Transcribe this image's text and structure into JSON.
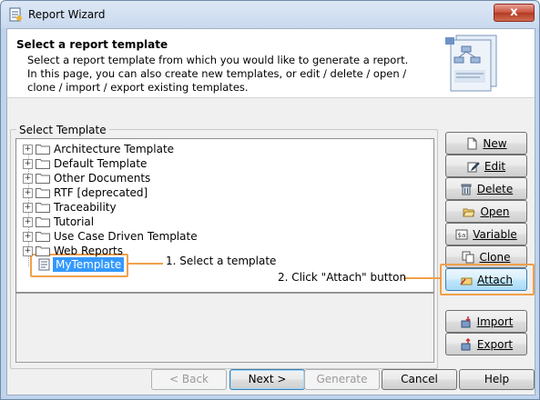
{
  "window": {
    "title": "Report Wizard",
    "close_glyph": "x"
  },
  "header": {
    "title": "Select a report template",
    "description": "Select a report template from which you would like to generate a report. In this page, you can also create new templates, or edit / delete / open / clone / import / export existing templates."
  },
  "template_group": {
    "label": "Select Template",
    "items": [
      {
        "label": "Architecture Template",
        "icon": "folder-icon"
      },
      {
        "label": "Default Template",
        "icon": "folder-icon"
      },
      {
        "label": "Other Documents",
        "icon": "folder-icon"
      },
      {
        "label": "RTF [deprecated]",
        "icon": "folder-icon"
      },
      {
        "label": "Traceability",
        "icon": "folder-icon"
      },
      {
        "label": "Tutorial",
        "icon": "folder-icon"
      },
      {
        "label": "Use Case Driven Template",
        "icon": "folder-icon"
      },
      {
        "label": "Web Reports",
        "icon": "folder-icon"
      }
    ],
    "selected": {
      "label": "MyTemplate",
      "icon": "template-file-icon"
    }
  },
  "side_buttons": {
    "new": "New",
    "edit": "Edit",
    "delete": "Delete",
    "open": "Open",
    "variable": "Variable",
    "clone": "Clone",
    "attach": "Attach",
    "import": "Import",
    "export": "Export"
  },
  "footer": {
    "back": "< Back",
    "next": "Next >",
    "generate": "Generate",
    "cancel": "Cancel",
    "help": "Help"
  },
  "annotations": {
    "step1": "1. Select a template",
    "step2": "2. Click \"Attach\" button",
    "highlight_color": "#f0a04b"
  },
  "colors": {
    "selection": "#3399ff",
    "title_bar": "#c9d9ee",
    "close_button": "#c9503b"
  }
}
